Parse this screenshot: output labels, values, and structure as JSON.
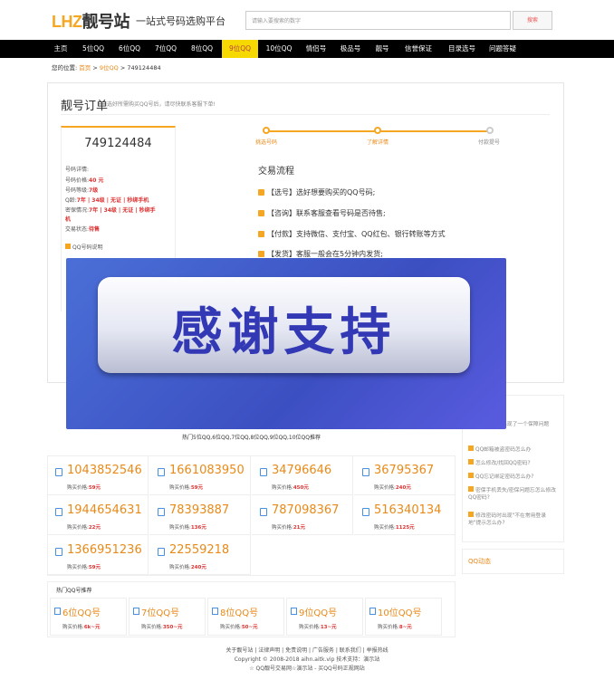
{
  "header": {
    "logo_en": "LHZ",
    "logo_cn": "靓号站",
    "slogan": "一站式号码选购平台",
    "search_placeholder": "请输入要搜索的数字",
    "search_button": "搜索"
  },
  "nav": [
    "主页",
    "5位QQ",
    "6位QQ",
    "7位QQ",
    "8位QQ",
    "9位QQ",
    "10位QQ",
    "情侣号",
    "极品号",
    "靓号",
    "信誉保证",
    "目录选号",
    "问题答疑"
  ],
  "nav_active": "9位QQ",
  "breadcrumb": {
    "prefix": "您的位置:",
    "home": "首页",
    "cat": "9位QQ",
    "current": "749124484",
    "sep": ">"
  },
  "order": {
    "title": "靓号订单",
    "subtitle": "选好所需购买QQ号后，请尽快联系客服下单!",
    "number": "749124484",
    "details_label": "号码详情:",
    "price_label": "号码价格:",
    "price": "40 元",
    "level_label": "号码等级:",
    "level": "7级",
    "q_label": "Q龄:",
    "q_value": "7年 | 34级 | 无证 | 秒绑手机",
    "credit_label": "密保情况:",
    "credit_value": "7年 | 34级 | 无证 | 秒绑手",
    "credit_value2": "机",
    "status_label": "交易状态:",
    "status": "待售",
    "note": "QQ号码说明"
  },
  "steps": [
    "挑选号码",
    "了解详情",
    "付款提号"
  ],
  "flow": {
    "title": "交易流程",
    "items": [
      "【选号】选好想要购买的QQ号码;",
      "【咨询】联系客服查看号码是否待售;",
      "【付款】支持微信、支付宝、QQ红包、银行转账等方式",
      "【发货】客服一般会在5分钟内发货;"
    ]
  },
  "thanks": "感谢支持",
  "side": [
    "密保手机未出现了一个保障问题",
    "QQ邮箱被盗密码怎么办",
    "怎么修改/找回QQ密码?",
    "QQ忘记绑定密码怎么办?",
    "密保手机丢失/密保问题忘怎么修改QQ密码?",
    "修改密码时出现\"不在常用登录地\"提示怎么办?"
  ],
  "side_title2": "QQ动态",
  "hot_title": "热门5位QQ,6位QQ,7位QQ,8位QQ,9位QQ,10位QQ推荐",
  "price_label": "购买价格:",
  "rec": [
    {
      "n": "1043852546",
      "p": "59元"
    },
    {
      "n": "1661083950",
      "p": "59元"
    },
    {
      "n": "34796646",
      "p": "450元"
    },
    {
      "n": "36795367",
      "p": "240元"
    },
    {
      "n": "1944654631",
      "p": "22元"
    },
    {
      "n": "78393887",
      "p": "136元"
    },
    {
      "n": "787098367",
      "p": "21元"
    },
    {
      "n": "516340134",
      "p": "1125元"
    },
    {
      "n": "1366951236",
      "p": "59元"
    },
    {
      "n": "22559218",
      "p": "240元"
    }
  ],
  "hot_qq_title": "热门QQ号推荐",
  "hot_qq": [
    {
      "n": "6位QQ号",
      "p": "6k~元"
    },
    {
      "n": "7位QQ号",
      "p": "350~元"
    },
    {
      "n": "8位QQ号",
      "p": "50~元"
    },
    {
      "n": "9位QQ号",
      "p": "13~元"
    },
    {
      "n": "10位QQ号",
      "p": "8~元"
    }
  ],
  "footer": {
    "links": "关于靓号站 | 法律声明 | 免责说明 | 广告服务 | 联系我们 | 举报热线",
    "copyright": "Copyright © 2008-2018 aihn.aitk.vip 技术支持：演示站",
    "line3": "☆ QQ靓号交易网☆演示站 - 买QQ号码正规网站"
  },
  "colors": {
    "accent": "#f5a623",
    "nav_bg": "#000000",
    "nav_active": "#f5d900",
    "price": "#dd3333",
    "banner": "#3c4fc2"
  }
}
